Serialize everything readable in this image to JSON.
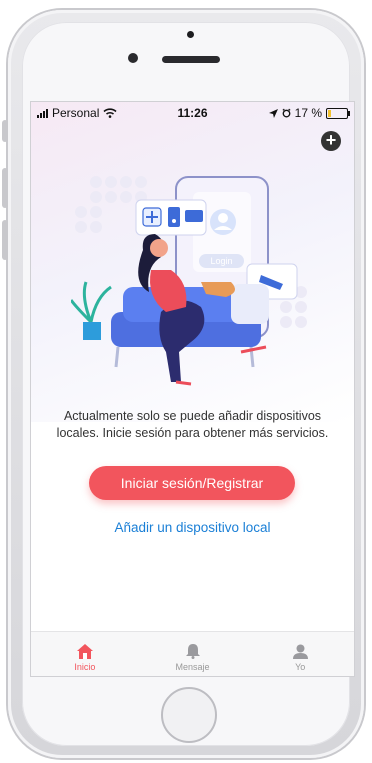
{
  "status_bar": {
    "carrier": "Personal",
    "time": "11:26",
    "battery": "17 %"
  },
  "header": {
    "add_icon": "plus-circle-icon"
  },
  "illustration": {
    "login_label": "Login"
  },
  "main": {
    "message": "Actualmente solo se puede añadir dispositivos locales. Inicie sesión para obtener más servicios.",
    "login_button": "Iniciar sesión/Registrar",
    "add_local_link": "Añadir un dispositivo local"
  },
  "tabs": [
    {
      "label": "Inicio",
      "icon": "home-icon",
      "active": true
    },
    {
      "label": "Mensaje",
      "icon": "bell-icon",
      "active": false
    },
    {
      "label": "Yo",
      "icon": "user-icon",
      "active": false
    }
  ],
  "colors": {
    "accent": "#f2555d",
    "link": "#1a7fd6"
  }
}
